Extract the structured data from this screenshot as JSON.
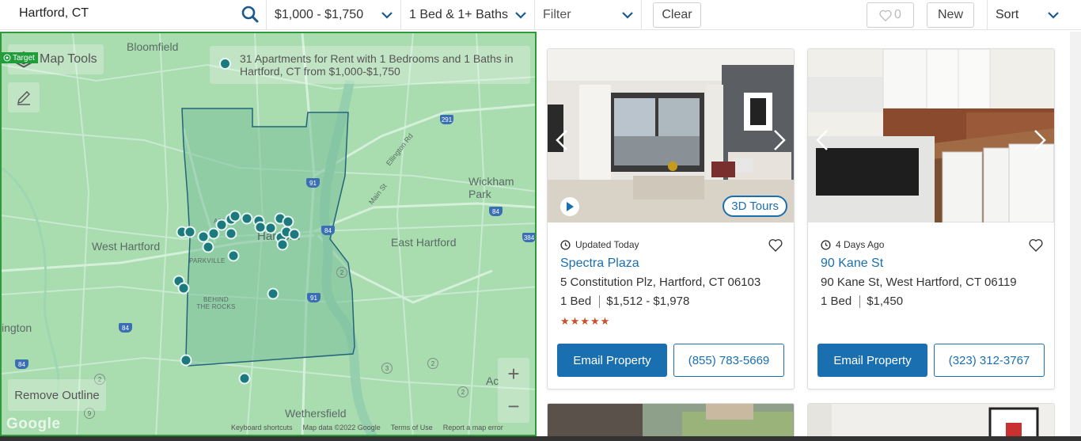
{
  "search": {
    "value": "Hartford, CT"
  },
  "filters": {
    "price": "$1,000 - $1,750",
    "beds": "1 Bed & 1+ Baths",
    "filter": "Filter",
    "clear": "Clear",
    "favorites_count": "0",
    "new": "New",
    "sort": "Sort"
  },
  "map": {
    "target_tag": "Target",
    "tools_label": "Map Tools",
    "results_text": "31 Apartments for Rent with 1 Bedrooms and 1 Baths in Hartford, CT from $1,000-$1,750",
    "remove_outline": "Remove Outline",
    "zoom_in": "+",
    "zoom_out": "−",
    "logo": "Google",
    "attribution": [
      "Keyboard shortcuts",
      "Map data ©2022 Google",
      "Terms of Use",
      "Report a map error"
    ],
    "places": {
      "bloomfield": "Bloomfield",
      "west_hartford": "West Hartford",
      "east_hartford": "East Hartford",
      "wickham_park": "Wickham Park",
      "hartford": "Hartford",
      "wethersfield": "Wethersfield",
      "ington": "ington",
      "parkville": "PARKVILLE",
      "behind_the_rocks": "BEHIND THE ROCKS",
      "asylum": "ASY",
      "ac": "Ac",
      "main_st": "Main St",
      "ellington_rd": "Ellington Rd"
    },
    "route_shields": [
      "291",
      "91",
      "84",
      "84",
      "384",
      "91",
      "84",
      "84",
      "2",
      "2",
      "3",
      "2",
      "9",
      "2"
    ]
  },
  "listings": [
    {
      "updated": "Updated Today",
      "name": "Spectra Plaza",
      "address": "5 Constitution Plz, Hartford, CT 06103",
      "beds": "1 Bed",
      "price": "$1,512 - $1,978",
      "rating": "★★★★★",
      "badge": "3D Tours",
      "email": "Email Property",
      "phone": "(855) 783-5669"
    },
    {
      "updated": "4 Days Ago",
      "name": "90 Kane St",
      "address": "90 Kane St, West Hartford, CT 06119",
      "beds": "1 Bed",
      "price": "$1,450",
      "email": "Email Property",
      "phone": "(323) 312-3767"
    }
  ],
  "colors": {
    "accent": "#1a6fb0",
    "pin": "#1c7a7e",
    "map": "#a9dcae",
    "stars": "#c8502b"
  }
}
